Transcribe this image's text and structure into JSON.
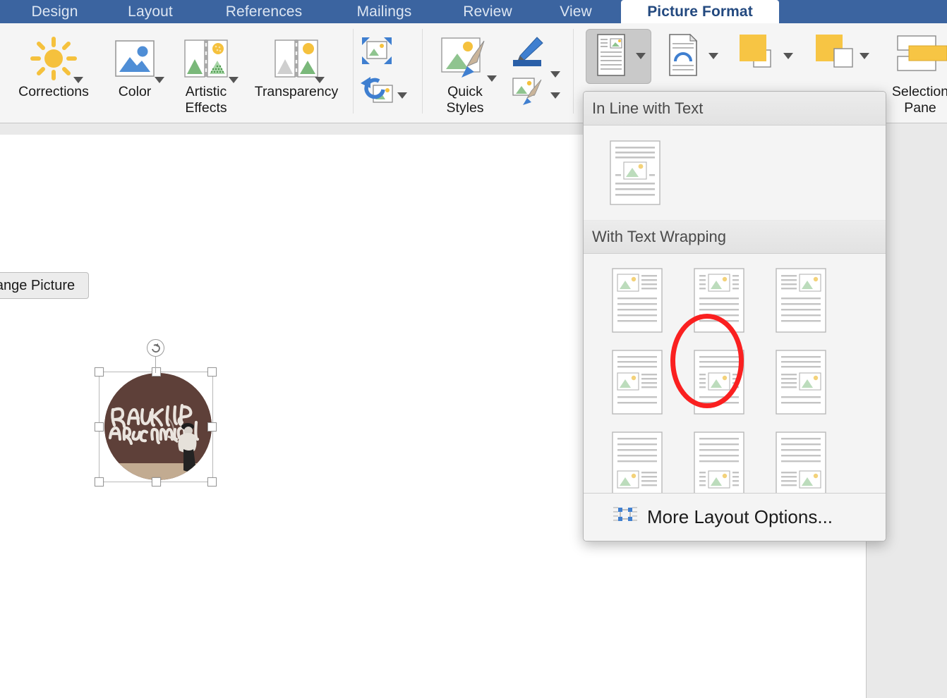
{
  "window": {
    "app": "Microsoft Word",
    "active_tab": "Picture Format"
  },
  "tabs": [
    {
      "label": "Design",
      "active": false
    },
    {
      "label": "Layout",
      "active": false
    },
    {
      "label": "References",
      "active": false
    },
    {
      "label": "Mailings",
      "active": false
    },
    {
      "label": "Review",
      "active": false
    },
    {
      "label": "View",
      "active": false
    },
    {
      "label": "Picture Format",
      "active": true
    }
  ],
  "ribbon": {
    "adjust_group": [
      {
        "label": "Corrections",
        "icon": "sun-brightness-icon",
        "has_caret": true
      },
      {
        "label": "Color",
        "icon": "picture-color-icon",
        "has_caret": true
      },
      {
        "label": "Artistic\nEffects",
        "icon": "artistic-effects-icon",
        "has_caret": true
      },
      {
        "label": "Transparency",
        "icon": "transparency-icon",
        "has_caret": true
      }
    ],
    "small_buttons": [
      {
        "label": "",
        "icon": "compress-pictures-icon",
        "has_caret": false
      },
      {
        "label": "",
        "icon": "reset-picture-icon",
        "has_caret": true
      }
    ],
    "styles_group": [
      {
        "label": "Quick\nStyles",
        "icon": "quick-styles-icon",
        "has_caret": true
      },
      {
        "label": "",
        "icon": "picture-border-icon",
        "has_caret": true
      },
      {
        "label": "",
        "icon": "picture-effects-icon",
        "has_caret": true
      }
    ],
    "arrange_group": [
      {
        "label": "",
        "icon": "position-icon",
        "has_caret": true,
        "pressed": true
      },
      {
        "label": "",
        "icon": "wrap-text-icon",
        "has_caret": true,
        "pressed": false
      },
      {
        "label": "",
        "icon": "bring-forward-icon",
        "has_caret": true,
        "pressed": false
      },
      {
        "label": "",
        "icon": "send-backward-icon",
        "has_caret": true,
        "pressed": false
      },
      {
        "label": "Selection\nPane",
        "icon": "selection-pane-icon",
        "has_caret": false,
        "pressed": false
      }
    ]
  },
  "document": {
    "change_picture_button": "ange Picture",
    "change_picture_full_label": "Change Picture",
    "selected_image": {
      "alt": "Circular cropped graffiti photograph",
      "graffiti_line1": "BLANK WALLS",
      "graffiti_line2": "ARE CRIMINAL",
      "selected": true,
      "rotate_handle_icon": "rotate-icon"
    }
  },
  "dropdown": {
    "name": "Position",
    "sections": [
      {
        "title": "In Line with Text",
        "items": [
          {
            "name": "in-line-with-text",
            "layout": "inline",
            "highlighted": false
          }
        ]
      },
      {
        "title": "With Text Wrapping",
        "items": [
          {
            "name": "position-top-left",
            "layout": "top-left",
            "highlighted": false
          },
          {
            "name": "position-top-center",
            "layout": "top-center",
            "highlighted": false
          },
          {
            "name": "position-top-right",
            "layout": "top-right",
            "highlighted": false
          },
          {
            "name": "position-middle-left",
            "layout": "middle-left",
            "highlighted": false
          },
          {
            "name": "position-middle-center",
            "layout": "middle-center",
            "highlighted": true
          },
          {
            "name": "position-middle-right",
            "layout": "middle-right",
            "highlighted": false
          },
          {
            "name": "position-bottom-left",
            "layout": "bottom-left",
            "highlighted": false
          },
          {
            "name": "position-bottom-center",
            "layout": "bottom-center",
            "highlighted": false
          },
          {
            "name": "position-bottom-right",
            "layout": "bottom-right",
            "highlighted": false
          }
        ]
      }
    ],
    "footer": {
      "label": "More Layout Options...",
      "icon": "layout-options-icon"
    }
  },
  "annotation": {
    "type": "ellipse-highlight",
    "color": "#fa2020",
    "target": "position-middle-center"
  },
  "colors": {
    "ribbon_tab_bar": "#3b64a0",
    "active_tab_text": "#23497f",
    "ribbon_background": "#f5f5f5",
    "document_background": "#e9e9e9",
    "page": "#ffffff",
    "annotation_red": "#fa2020",
    "accent_yellow": "#f7c544",
    "accent_blue": "#3f7fd0",
    "accent_green": "#8fc48f"
  }
}
